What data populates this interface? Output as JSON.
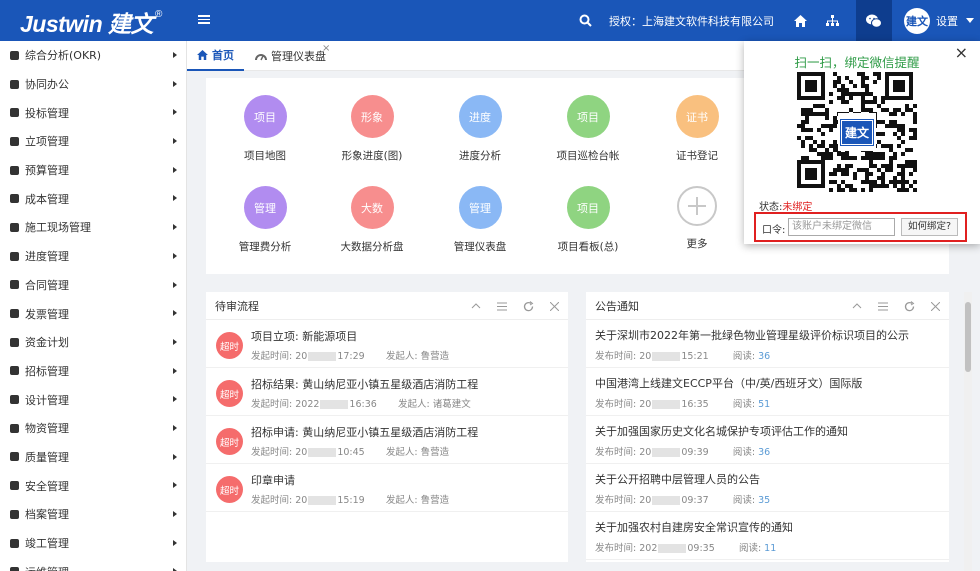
{
  "header": {
    "logo": "Justwin 建文",
    "logo_mark": "®",
    "auth_text": "授权：上海建文软件科技有限公司",
    "avatar_text": "建文",
    "settings_label": "设置"
  },
  "sidebar": {
    "items": [
      {
        "label": "综合分析(OKR)",
        "icon": "pie-chart-icon"
      },
      {
        "label": "协同办公",
        "icon": "users-icon"
      },
      {
        "label": "投标管理",
        "icon": "target-icon"
      },
      {
        "label": "立项管理",
        "icon": "edit-icon"
      },
      {
        "label": "预算管理",
        "icon": "calculator-icon"
      },
      {
        "label": "成本管理",
        "icon": "cost-icon"
      },
      {
        "label": "施工现场管理",
        "icon": "site-icon"
      },
      {
        "label": "进度管理",
        "icon": "list-icon"
      },
      {
        "label": "合同管理",
        "icon": "file-icon"
      },
      {
        "label": "发票管理",
        "icon": "invoice-icon"
      },
      {
        "label": "资金计划",
        "icon": "money-icon"
      },
      {
        "label": "招标管理",
        "icon": "bid-icon"
      },
      {
        "label": "设计管理",
        "icon": "tools-icon"
      },
      {
        "label": "物资管理",
        "icon": "box-icon"
      },
      {
        "label": "质量管理",
        "icon": "diamond-icon"
      },
      {
        "label": "安全管理",
        "icon": "shield-icon"
      },
      {
        "label": "档案管理",
        "icon": "archive-icon"
      },
      {
        "label": "竣工管理",
        "icon": "flag-icon"
      },
      {
        "label": "运维管理",
        "icon": "wrench-icon"
      }
    ]
  },
  "tabs": {
    "home": "首页",
    "dashboard": "管理仪表盘",
    "close_glyph": "×"
  },
  "apps": [
    {
      "circle": "项目",
      "label": "项目地图",
      "color": "#b18cf0"
    },
    {
      "circle": "形象",
      "label": "形象进度(图)",
      "color": "#f78e8e"
    },
    {
      "circle": "进度",
      "label": "进度分析",
      "color": "#8ab8f5"
    },
    {
      "circle": "项目",
      "label": "项目巡检台帐",
      "color": "#8fd481"
    },
    {
      "circle": "证书",
      "label": "证书登记",
      "color": "#f9c07f"
    },
    {
      "circle": "管理",
      "label": "管理费分析",
      "color": "#b18cf0"
    },
    {
      "circle": "大数",
      "label": "大数据分析盘",
      "color": "#f78e8e"
    },
    {
      "circle": "管理",
      "label": "管理仪表盘",
      "color": "#8ab8f5"
    },
    {
      "circle": "项目",
      "label": "项目看板(总)",
      "color": "#8fd481"
    },
    {
      "circle": "+",
      "label": "更多",
      "color": "#ffffff"
    }
  ],
  "todo": {
    "title": "待审流程",
    "badge": "超时",
    "time_label": "发起时间:",
    "initiator_label": "发起人:",
    "rows": [
      {
        "title": "项目立项: 新能源项目",
        "time_prefix": "20",
        "time_suffix": "17:29",
        "initiator": "鲁营造"
      },
      {
        "title": "招标结果: 黄山纳尼亚小镇五星级酒店消防工程",
        "time_prefix": "2022",
        "time_suffix": "16:36",
        "initiator": "诸葛建文"
      },
      {
        "title": "招标申请: 黄山纳尼亚小镇五星级酒店消防工程",
        "time_prefix": "20",
        "time_suffix": "10:45",
        "initiator": "鲁营造"
      },
      {
        "title": "印章申请",
        "time_prefix": "20",
        "time_suffix": "15:19",
        "initiator": "鲁营造"
      }
    ]
  },
  "notices": {
    "title": "公告通知",
    "time_label": "发布时间:",
    "read_label": "阅读:",
    "rows": [
      {
        "title": "关于深圳市2022年第一批绿色物业管理星级评价标识项目的公示",
        "time_prefix": "20",
        "time_suffix": "15:21",
        "reads": "36"
      },
      {
        "title": "中国港湾上线建文ECCP平台（中/英/西班牙文）国际版",
        "time_prefix": "20",
        "time_suffix": "16:35",
        "reads": "51"
      },
      {
        "title": "关于加强国家历史文化名城保护专项评估工作的通知",
        "time_prefix": "20",
        "time_suffix": "09:39",
        "reads": "36"
      },
      {
        "title": "关于公开招聘中层管理人员的公告",
        "time_prefix": "20",
        "time_suffix": "09:37",
        "reads": "35"
      },
      {
        "title": "关于加强农村自建房安全常识宣传的通知",
        "time_prefix": "202",
        "time_suffix": "09:35",
        "reads": "11"
      }
    ]
  },
  "wechat_popup": {
    "title": "扫一扫，绑定微信提醒",
    "qr_logo": "建文",
    "status_label": "状态:",
    "status_value": "未绑定",
    "token_label": "口令:",
    "token_placeholder": "该账户未绑定微信",
    "how_button": "如何绑定?",
    "close_glyph": "×"
  },
  "colors": {
    "header_bg": "#1a56b8",
    "accent": "#1a56b8",
    "late_badge": "#f56c6c",
    "popup_title": "#2e9b46",
    "unbound": "#e02020"
  }
}
